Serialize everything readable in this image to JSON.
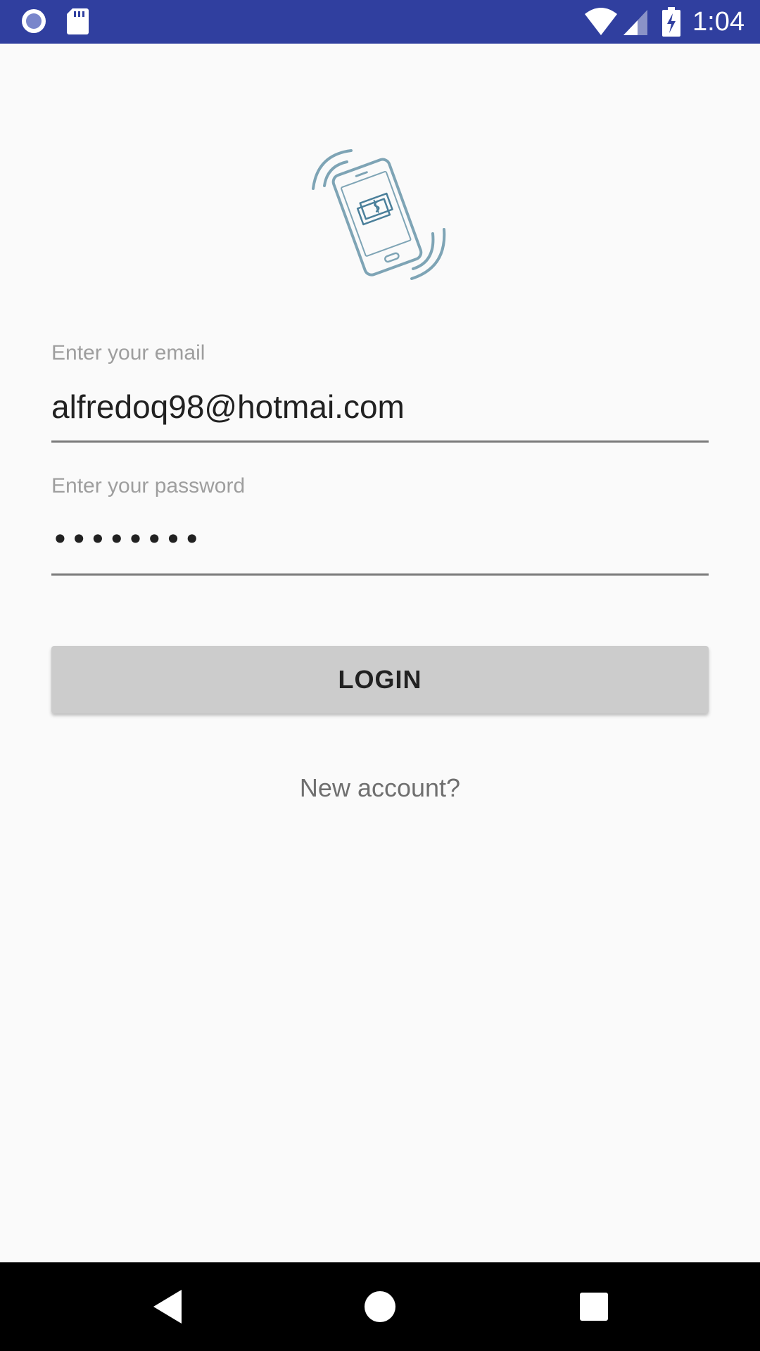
{
  "status_bar": {
    "time": "1:04",
    "icons": [
      "record-icon",
      "sd-card-icon",
      "wifi-icon",
      "cell-signal-icon",
      "battery-charging-icon"
    ],
    "background": "#303f9f"
  },
  "logo": {
    "icon": "phone-money-icon",
    "color": "#7ea4b5"
  },
  "email": {
    "label": "Enter your email",
    "value": "alfredoq98@hotmai.com"
  },
  "password": {
    "label": "Enter your password",
    "value": "••••••••"
  },
  "login_button": {
    "label": "LOGIN"
  },
  "new_account": {
    "label": "New account?"
  },
  "nav_bar": {
    "icons": [
      "back-icon",
      "home-icon",
      "recents-icon"
    ]
  }
}
